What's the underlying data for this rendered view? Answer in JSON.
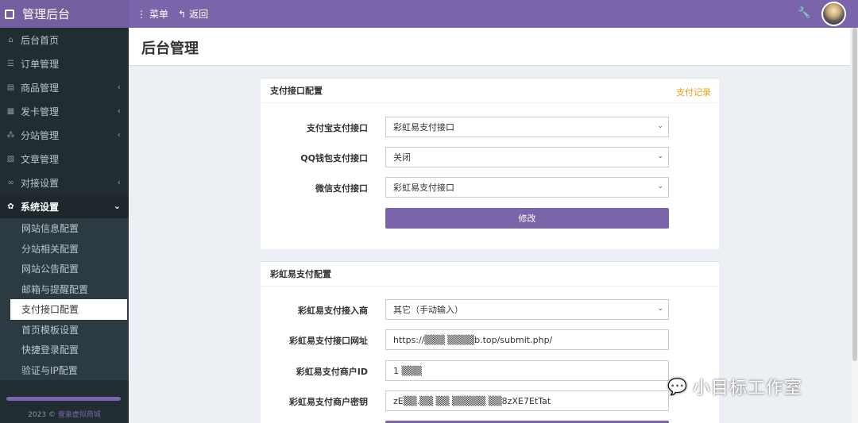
{
  "topbar": {
    "brand_title": "管理后台",
    "menu_icon": "menu-dots-icon",
    "menu_label": "菜单",
    "back_icon": "back-arrow-icon",
    "back_label": "返回",
    "wrench_icon": "wrench-icon",
    "accent_color": "#7b65aa"
  },
  "sidebar": {
    "items": [
      {
        "label": "后台首页",
        "icon": "home-icon",
        "glyph": "⌂",
        "has_chevron": false
      },
      {
        "label": "订单管理",
        "icon": "list-icon",
        "glyph": "☰",
        "has_chevron": false
      },
      {
        "label": "商品管理",
        "icon": "cart-icon",
        "glyph": "▤",
        "has_chevron": true
      },
      {
        "label": "发卡管理",
        "icon": "grid-icon",
        "glyph": "▦",
        "has_chevron": true
      },
      {
        "label": "分站管理",
        "icon": "sitemap-icon",
        "glyph": "⁂",
        "has_chevron": true
      },
      {
        "label": "文章管理",
        "icon": "article-icon",
        "glyph": "▧",
        "has_chevron": false
      },
      {
        "label": "对接设置",
        "icon": "link-icon",
        "glyph": "∞",
        "has_chevron": true
      },
      {
        "label": "系统设置",
        "icon": "gear-icon",
        "glyph": "✿",
        "has_chevron": true,
        "active": true
      }
    ],
    "submenu": [
      "网站信息配置",
      "分站相关配置",
      "网站公告配置",
      "邮箱与提醒配置",
      "支付接口配置",
      "首页模板设置",
      "快捷登录配置",
      "验证与IP配置"
    ],
    "active_sub_index": 4,
    "footer_prefix": "2023 ©",
    "footer_link": "壹豪虚拟商城"
  },
  "content": {
    "page_title": "后台管理"
  },
  "pay_box": {
    "title": "支付接口配置",
    "records_link": "支付记录",
    "fields": [
      {
        "label": "支付宝支付接口",
        "value": "彩虹易支付接口"
      },
      {
        "label": "QQ钱包支付接口",
        "value": "关闭"
      },
      {
        "label": "微信支付接口",
        "value": "彩虹易支付接口"
      }
    ],
    "submit_label": "修改"
  },
  "epay_box": {
    "title": "彩虹易支付配置",
    "fields": [
      {
        "label": "彩虹易支付接入商",
        "value": "其它（手动输入）",
        "type": "select"
      },
      {
        "label": "彩虹易支付接口网址",
        "value": "https://▒▒▒ ▒▒▒▒b.top/submit.php/",
        "type": "input"
      },
      {
        "label": "彩虹易支付商户ID",
        "value": "1 ▒▒▒",
        "type": "input"
      },
      {
        "label": "彩虹易支付商户密钥",
        "value": "zE▒▒.▒▒ ▒▒ ▒▒▒▒▒ ▒▒8zXE7EtTat",
        "type": "input"
      }
    ]
  },
  "watermark": {
    "text": "小目标工作室",
    "icon": "wechat-icon"
  }
}
